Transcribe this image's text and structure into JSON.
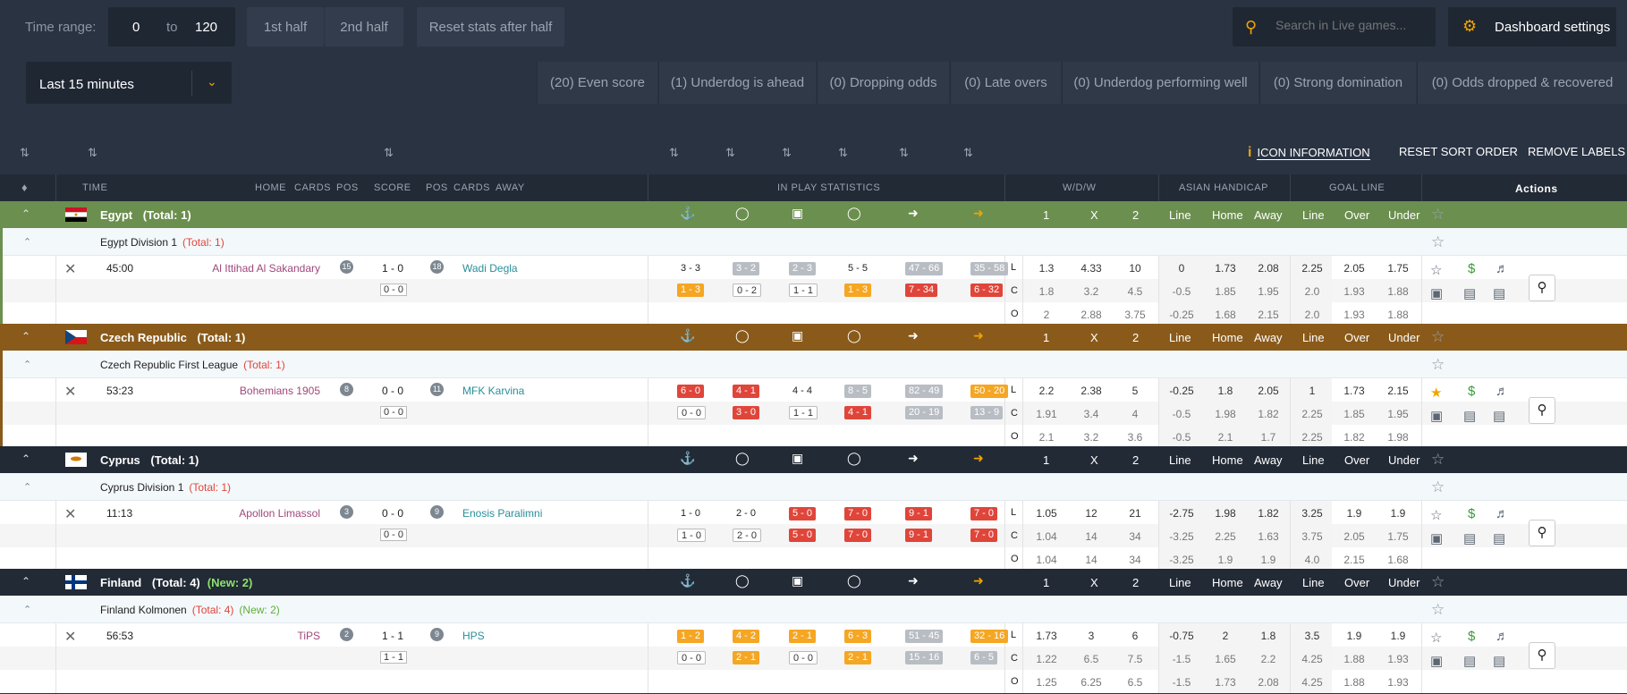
{
  "top": {
    "time_range_label": "Time range:",
    "range_from": "0",
    "range_to_word": "to",
    "range_to": "120",
    "first_half": "1st half",
    "second_half": "2nd half",
    "reset_stats": "Reset stats after half",
    "search_placeholder": "Search in Live games...",
    "dashboard_settings": "Dashboard settings",
    "period_select": "Last 15 minutes"
  },
  "filters": [
    "(20) Even score",
    "(1) Underdog is ahead",
    "(0) Dropping odds",
    "(0) Late overs",
    "(0) Underdog performing well",
    "(0) Strong domination",
    "(0) Odds dropped & recovered"
  ],
  "toolbar": {
    "icon_information": "ICON INFORMATION",
    "reset_sort": "RESET SORT ORDER",
    "remove_labels": "REMOVE LABELS"
  },
  "header": {
    "time": "TIME",
    "home": "HOME",
    "cards": "CARDS",
    "pos": "POS",
    "score": "SCORE",
    "pos2": "POS",
    "cards2": "CARDS",
    "away": "AWAY",
    "inplay": "IN PLAY STATISTICS",
    "wdw": "W/D/W",
    "asian": "ASIAN HANDICAP",
    "goalline": "GOAL LINE",
    "actions": "Actions"
  },
  "subhdr": {
    "one": "1",
    "x": "X",
    "two": "2",
    "line": "Line",
    "home": "Home",
    "away": "Away",
    "line2": "Line",
    "over": "Over",
    "under": "Under"
  },
  "colors": {
    "egypt": "#6b8f4e",
    "czech": "#8a5a1a",
    "dark": "#222a36",
    "accent": "#f0a500"
  },
  "groups": [
    {
      "country": "Egypt",
      "country_total": "(Total: 1)",
      "country_new": "",
      "league": "Egypt Division 1",
      "league_total": "(Total: 1)",
      "league_new": "",
      "match": {
        "time": "45:00",
        "home": "Al Ittihad Al Sakandary",
        "home_pos": "15",
        "score": "1 - 0",
        "away_pos": "18",
        "away": "Wadi Degla",
        "ht": "0 - 0",
        "stats1": [
          "3 - 3",
          "3 - 2",
          "2 - 3",
          "5 - 5",
          "47 - 66",
          "35 - 58"
        ],
        "stats2": [
          "1 - 3",
          "0 - 2",
          "1 - 1",
          "1 - 3",
          "7 - 34",
          "6 - 32"
        ],
        "odds": [
          [
            "L",
            "1.3",
            "4.33",
            "10",
            "0",
            "1.73",
            "2.08",
            "2.25",
            "2.05",
            "1.75"
          ],
          [
            "C",
            "1.8",
            "3.2",
            "4.5",
            "-0.5",
            "1.85",
            "1.95",
            "2.0",
            "1.93",
            "1.88"
          ],
          [
            "O",
            "2",
            "2.88",
            "3.75",
            "-0.25",
            "1.68",
            "2.15",
            "2.0",
            "1.93",
            "1.88"
          ]
        ]
      }
    },
    {
      "country": "Czech Republic",
      "country_total": "(Total: 1)",
      "country_new": "",
      "league": "Czech Republic First League",
      "league_total": "(Total: 1)",
      "league_new": "",
      "match": {
        "time": "53:23",
        "home": "Bohemians 1905",
        "home_pos": "8",
        "score": "0 - 0",
        "away_pos": "11",
        "away": "MFK Karvina",
        "ht": "0 - 0",
        "stats1": [
          "6 - 0",
          "4 - 1",
          "4 - 4",
          "8 - 5",
          "82 - 49",
          "50 - 20"
        ],
        "stats2": [
          "0 - 0",
          "3 - 0",
          "1 - 1",
          "4 - 1",
          "20 - 19",
          "13 - 9"
        ],
        "odds": [
          [
            "L",
            "2.2",
            "2.38",
            "5",
            "-0.25",
            "1.8",
            "2.05",
            "1",
            "1.73",
            "2.15"
          ],
          [
            "C",
            "1.91",
            "3.4",
            "4",
            "-0.5",
            "1.98",
            "1.82",
            "2.25",
            "1.85",
            "1.95"
          ],
          [
            "O",
            "2.1",
            "3.2",
            "3.6",
            "-0.5",
            "2.1",
            "1.7",
            "2.25",
            "1.82",
            "1.98"
          ]
        ]
      }
    },
    {
      "country": "Cyprus",
      "country_total": "(Total: 1)",
      "country_new": "",
      "league": "Cyprus Division 1",
      "league_total": "(Total: 1)",
      "league_new": "",
      "match": {
        "time": "11:13",
        "home": "Apollon Limassol",
        "home_pos": "3",
        "score": "0 - 0",
        "away_pos": "9",
        "away": "Enosis Paralimni",
        "ht": "0 - 0",
        "stats1": [
          "1 - 0",
          "2 - 0",
          "5 - 0",
          "7 - 0",
          "9 - 1",
          "7 - 0"
        ],
        "stats2": [
          "1 - 0",
          "2 - 0",
          "5 - 0",
          "7 - 0",
          "9 - 1",
          "7 - 0"
        ],
        "odds": [
          [
            "L",
            "1.05",
            "12",
            "21",
            "-2.75",
            "1.98",
            "1.82",
            "3.25",
            "1.9",
            "1.9"
          ],
          [
            "C",
            "1.04",
            "14",
            "34",
            "-3.25",
            "2.25",
            "1.63",
            "3.75",
            "2.05",
            "1.75"
          ],
          [
            "O",
            "1.04",
            "14",
            "34",
            "-3.25",
            "1.9",
            "1.9",
            "4.0",
            "2.15",
            "1.68"
          ]
        ]
      }
    },
    {
      "country": "Finland",
      "country_total": "(Total: 4)",
      "country_new": "(New: 2)",
      "league": "Finland Kolmonen",
      "league_total": "(Total: 4)",
      "league_new": "(New: 2)",
      "match": {
        "time": "56:53",
        "home": "TiPS",
        "home_pos": "2",
        "score": "1 - 1",
        "away_pos": "9",
        "away": "HPS",
        "ht": "1 - 1",
        "stats1": [
          "1 - 2",
          "4 - 2",
          "2 - 1",
          "6 - 3",
          "51 - 45",
          "32 - 16"
        ],
        "stats2": [
          "0 - 0",
          "2 - 1",
          "0 - 0",
          "2 - 1",
          "15 - 16",
          "6 - 5"
        ],
        "odds": [
          [
            "L",
            "1.73",
            "3",
            "6",
            "-0.75",
            "2",
            "1.8",
            "3.5",
            "1.9",
            "1.9"
          ],
          [
            "C",
            "1.22",
            "6.5",
            "7.5",
            "-1.5",
            "1.65",
            "2.2",
            "4.25",
            "1.88",
            "1.93"
          ],
          [
            "O",
            "1.25",
            "6.25",
            "6.5",
            "-1.5",
            "1.73",
            "2.08",
            "4.25",
            "1.88",
            "1.93"
          ]
        ]
      }
    }
  ]
}
